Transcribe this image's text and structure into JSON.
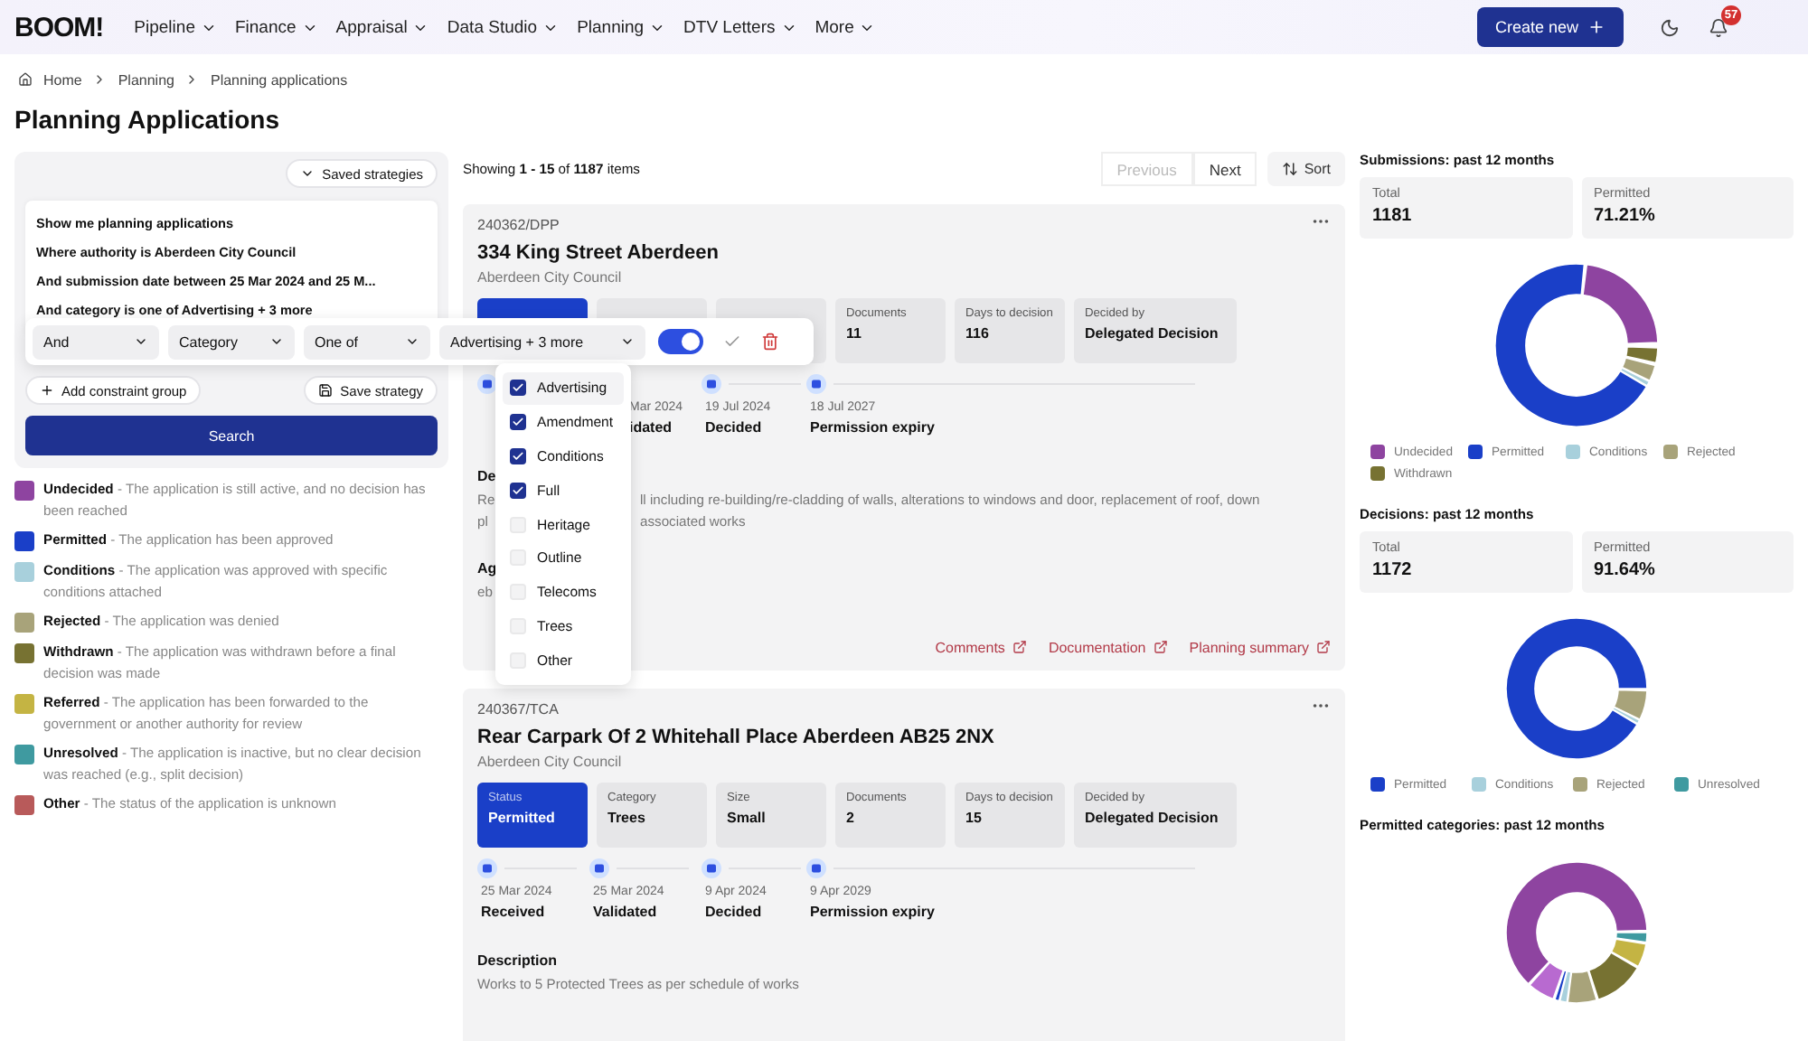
{
  "header": {
    "logo": "BOOM!",
    "nav": [
      {
        "label": "Pipeline"
      },
      {
        "label": "Finance"
      },
      {
        "label": "Appraisal"
      },
      {
        "label": "Data Studio"
      },
      {
        "label": "Planning"
      },
      {
        "label": "DTV Letters"
      },
      {
        "label": "More"
      }
    ],
    "create_button": "Create new",
    "notifications": "57"
  },
  "breadcrumb": [
    "Home",
    "Planning",
    "Planning applications"
  ],
  "page_title": "Planning Applications",
  "strategy": {
    "saved_button": "Saved strategies",
    "lines": [
      "Show me planning applications",
      "Where authority is Aberdeen City Council",
      "And submission date between 25 Mar 2024 and 25 M...",
      "And category is one of Advertising + 3 more"
    ],
    "filter": {
      "conjunction": "And",
      "field": "Category",
      "operator": "One of",
      "value": "Advertising + 3 more",
      "enabled": true
    },
    "options": [
      {
        "label": "Advertising",
        "checked": true
      },
      {
        "label": "Amendment",
        "checked": true
      },
      {
        "label": "Conditions",
        "checked": true
      },
      {
        "label": "Full",
        "checked": true
      },
      {
        "label": "Heritage",
        "checked": false
      },
      {
        "label": "Outline",
        "checked": false
      },
      {
        "label": "Telecoms",
        "checked": false
      },
      {
        "label": "Trees",
        "checked": false
      },
      {
        "label": "Other",
        "checked": false
      }
    ],
    "add_group": "Add constraint group",
    "save": "Save strategy",
    "search": "Search"
  },
  "status_legend": [
    {
      "text": "**Undecided** - The application is still active, and no decision has been reached",
      "color": "#8e44a0"
    },
    {
      "text": "**Permitted** - The application has been approved",
      "color": "#1a3fc8"
    },
    {
      "text": "**Conditions** - The application was approved with specific conditions attached",
      "color": "#a8d0dc"
    },
    {
      "text": "**Rejected** - The application was denied",
      "color": "#a8a37a"
    },
    {
      "text": "**Withdrawn** - The application was withdrawn before a final decision was made",
      "color": "#777232"
    },
    {
      "text": "**Referred** - The application has been forwarded to the government or another authority for review",
      "color": "#c4b443"
    },
    {
      "text": "**Unresolved** - The application is inactive, but no clear decision was reached (e.g., split decision)",
      "color": "#3f9aa0"
    },
    {
      "text": "**Other** - The status of the application is unknown",
      "color": "#b85a5a"
    }
  ],
  "results": {
    "summary": "Showing **1 - 15** of **1187** items",
    "previous": {
      "label": "Previous",
      "disabled": true
    },
    "next": {
      "label": "Next",
      "disabled": false
    },
    "sort": "Sort"
  },
  "applications": [
    {
      "reference": "240362/DPP",
      "title": "334 King Street Aberdeen",
      "council": "Aberdeen City Council",
      "stats": [
        {
          "kind": "status"
        },
        {
          "kind": "plain"
        },
        {
          "kind": "plain"
        },
        {
          "kind": "plain",
          "label": "Documents",
          "value": "11"
        },
        {
          "kind": "plain",
          "label": "Days to decision",
          "value": "116"
        },
        {
          "kind": "plain",
          "label": "Decided by",
          "value": "Delegated Decision"
        }
      ],
      "timeline": [
        {
          "kind": "hidden"
        },
        {
          "kind": "clipped",
          "date": "Mar 2024",
          "label": "idated"
        },
        {
          "kind": "full",
          "date": "19 Jul 2024",
          "label": "Decided"
        },
        {
          "kind": "full",
          "date": "18 Jul 2027",
          "label": "Permission expiry"
        }
      ],
      "description_label": "De",
      "description_fragments": [
        "Re",
        "pl"
      ],
      "description": [
        "ll including re-building/re-cladding of walls, alterations to windows and door, replacement of roof, down",
        "associated works"
      ],
      "agent_label": "Ag",
      "agent": "eb",
      "links": [
        "Comments",
        "Documentation",
        "Planning summary"
      ]
    },
    {
      "reference": "240367/TCA",
      "title": "Rear Carpark Of 2 Whitehall Place Aberdeen AB25 2NX",
      "council": "Aberdeen City Council",
      "stats": [
        {
          "kind": "status",
          "label": "Status",
          "value": "Permitted"
        },
        {
          "kind": "plain",
          "label": "Category",
          "value": "Trees"
        },
        {
          "kind": "plain",
          "label": "Size",
          "value": "Small"
        },
        {
          "kind": "plain",
          "label": "Documents",
          "value": "2"
        },
        {
          "kind": "plain",
          "label": "Days to decision",
          "value": "15"
        },
        {
          "kind": "plain",
          "label": "Decided by",
          "value": "Delegated Decision"
        }
      ],
      "timeline": [
        {
          "kind": "full",
          "date": "25 Mar 2024",
          "label": "Received"
        },
        {
          "kind": "full",
          "date": "25 Mar 2024",
          "label": "Validated"
        },
        {
          "kind": "full",
          "date": "9 Apr 2024",
          "label": "Decided"
        },
        {
          "kind": "full",
          "date": "9 Apr 2029",
          "label": "Permission expiry"
        }
      ],
      "description_label": "Description",
      "description": [
        "Works to 5 Protected Trees as per schedule of works"
      ]
    }
  ],
  "stats_panels": [
    {
      "kind": "submissions",
      "title": "Submissions: past 12 months",
      "tiles": [
        {
          "label": "Total",
          "value": "1181"
        },
        {
          "label": "Permitted",
          "value": "71.21%"
        }
      ],
      "legend": [
        {
          "label": "Undecided",
          "color": "#8e44a0"
        },
        {
          "label": "Permitted",
          "color": "#1a3fc8"
        },
        {
          "label": "Conditions",
          "color": "#a8d0dc"
        },
        {
          "label": "Rejected",
          "color": "#a8a37a"
        },
        {
          "label": "Withdrawn",
          "color": "#777232"
        }
      ]
    },
    {
      "kind": "decisions",
      "title": "Decisions: past 12 months",
      "tiles": [
        {
          "label": "Total",
          "value": "1172"
        },
        {
          "label": "Permitted",
          "value": "91.64%"
        }
      ],
      "legend": [
        {
          "label": "Permitted",
          "color": "#1a3fc8"
        },
        {
          "label": "Conditions",
          "color": "#a8d0dc"
        },
        {
          "label": "Rejected",
          "color": "#a8a37a"
        },
        {
          "label": "Unresolved",
          "color": "#3f9aa0"
        }
      ]
    },
    {
      "kind": "categories",
      "title": "Permitted categories: past 12 months"
    }
  ]
}
